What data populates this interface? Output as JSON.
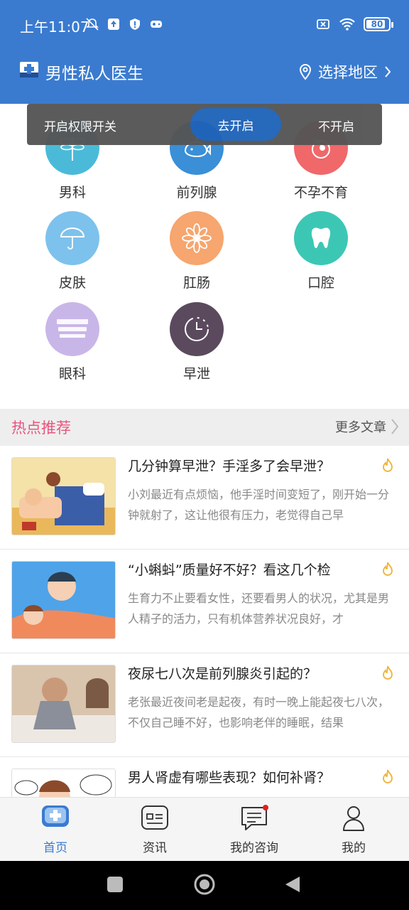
{
  "status_bar": {
    "time": "上午11:07",
    "battery": "80"
  },
  "header": {
    "title": "男性私人医生",
    "region_label": "选择地区"
  },
  "permission_toast": {
    "message": "开启权限开关",
    "enable_label": "去开启",
    "decline_label": "不开启"
  },
  "categories": [
    {
      "label": "男科",
      "color": "#4bbad8"
    },
    {
      "label": "前列腺",
      "color": "#3a8fd6"
    },
    {
      "label": "不孕不育",
      "color": "#f0686a"
    },
    {
      "label": "皮肤",
      "color": "#7dc2ec"
    },
    {
      "label": "肛肠",
      "color": "#f6a66e"
    },
    {
      "label": "口腔",
      "color": "#3cc7b5"
    },
    {
      "label": "眼科",
      "color": "#c9b6e8"
    },
    {
      "label": "早泄",
      "color": "#5b4a5e"
    }
  ],
  "section": {
    "title": "热点推荐",
    "more_label": "更多文章"
  },
  "articles": [
    {
      "title": "几分钟算早泄？手淫多了会早泄？",
      "desc": "小刘最近有点烦恼，他手淫时间变短了，刚开始一分钟就射了，这让他很有压力，老觉得自己早"
    },
    {
      "title": "“小蝌蚪”质量好不好？看这几个检",
      "desc": "生育力不止要看女性，还要看男人的状况，尤其是男人精子的活力，只有机体营养状况良好，才"
    },
    {
      "title": "夜尿七八次是前列腺炎引起的？",
      "desc": "老张最近夜间老是起夜，有时一晚上能起夜七八次，不仅自己睡不好，也影响老伴的睡眠，结果"
    },
    {
      "title": "男人肾虚有哪些表现？如何补肾？",
      "desc": ""
    }
  ],
  "bottom_nav": [
    {
      "label": "首页"
    },
    {
      "label": "资讯"
    },
    {
      "label": "我的咨询"
    },
    {
      "label": "我的"
    }
  ],
  "colors": {
    "brand": "#3a7bd0",
    "accent_pink": "#e8557e",
    "flame": "#f2b233"
  }
}
